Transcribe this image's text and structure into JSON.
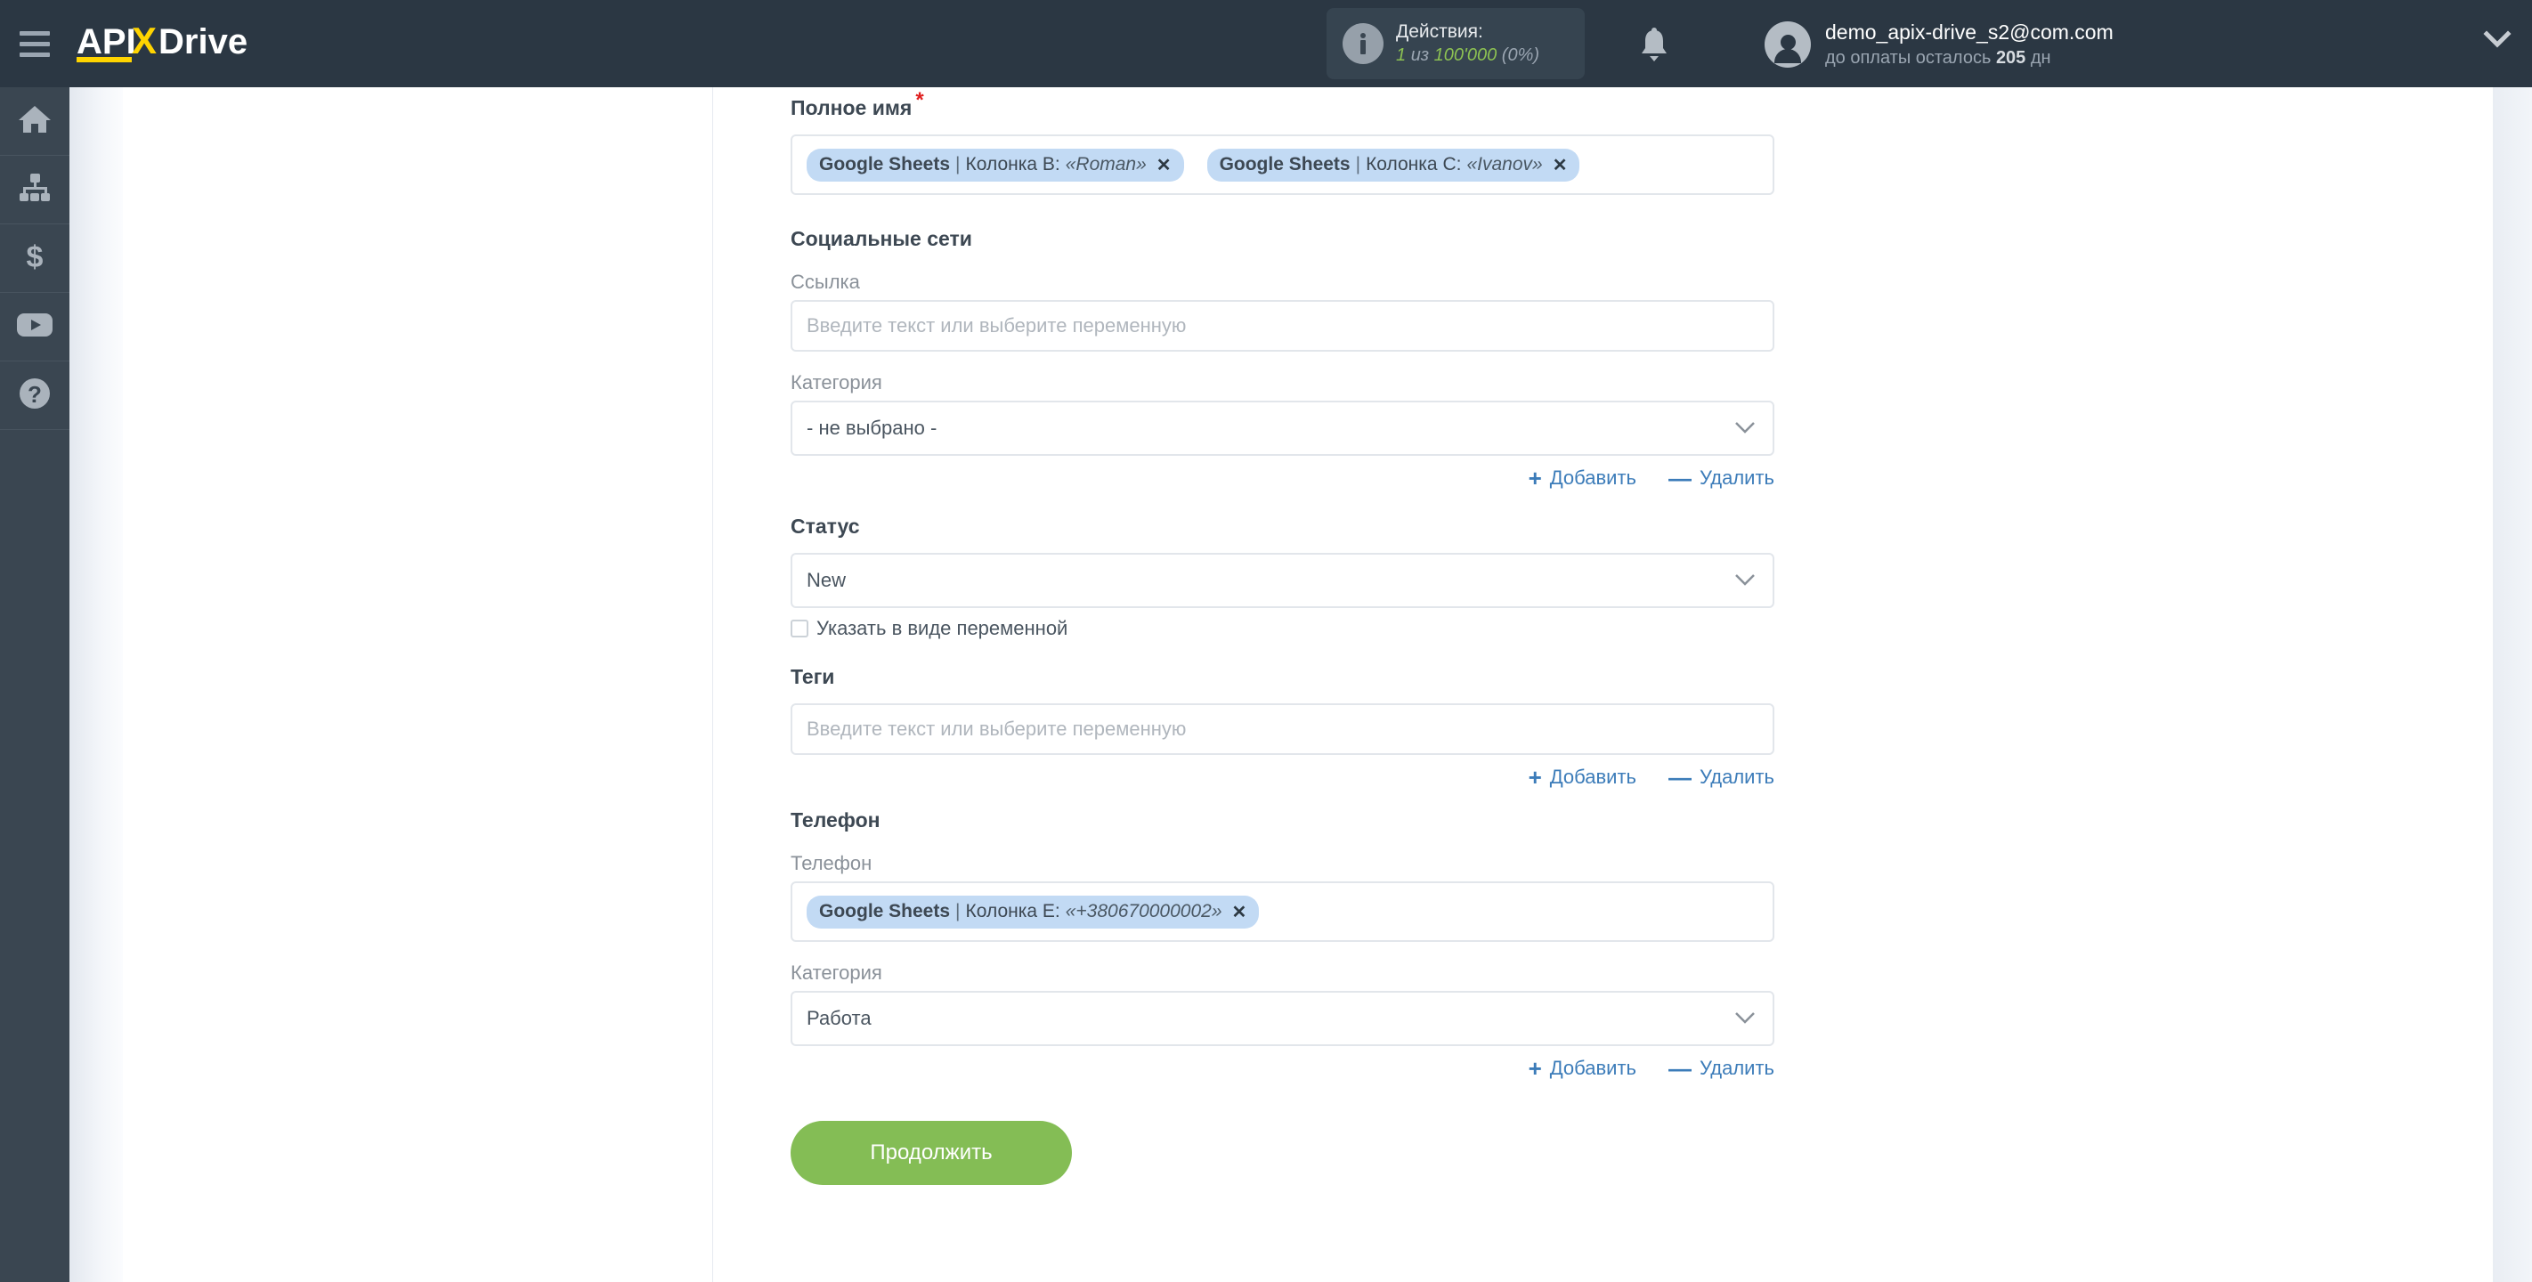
{
  "header": {
    "logo_text": "APIXDrive",
    "menu_icon": "hamburger-icon",
    "actions": {
      "title": "Действия:",
      "count": "1",
      "of": "из",
      "limit": "100'000",
      "percent": "(0%)"
    },
    "notifications_icon": "bell-icon",
    "user": {
      "email": "demo_apix-drive_s2@com.com",
      "billing_prefix": "до оплаты осталось",
      "billing_days": "205",
      "billing_suffix": "дн"
    },
    "chevron_icon": "chevron-down-icon"
  },
  "sidebar": {
    "items": [
      {
        "name": "home",
        "icon": "home-icon"
      },
      {
        "name": "connections",
        "icon": "sitemap-icon"
      },
      {
        "name": "billing",
        "icon": "dollar-icon"
      },
      {
        "name": "video",
        "icon": "youtube-play-icon"
      },
      {
        "name": "help",
        "icon": "question-circle-icon"
      }
    ]
  },
  "form": {
    "full_name": {
      "label": "Полное имя",
      "required_marker": "*",
      "chips": [
        {
          "source": "Google Sheets",
          "sep": "|",
          "field": "Колонка B:",
          "value": "«Roman»",
          "remove": "✕"
        },
        {
          "source": "Google Sheets",
          "sep": "|",
          "field": "Колонка C:",
          "value": "«Ivanov»",
          "remove": "✕"
        }
      ]
    },
    "social": {
      "section_title": "Социальные сети",
      "link_label": "Ссылка",
      "link_placeholder": "Введите текст или выберите переменную",
      "link_value": "",
      "category_label": "Категория",
      "category_value": "- не выбрано -",
      "add_label": "Добавить",
      "remove_label": "Удалить"
    },
    "status": {
      "section_title": "Статус",
      "value": "New",
      "checkbox_label": "Указать в виде переменной",
      "checked": false
    },
    "tags": {
      "section_title": "Теги",
      "placeholder": "Введите текст или выберите переменную",
      "value": "",
      "add_label": "Добавить",
      "remove_label": "Удалить"
    },
    "phone": {
      "section_title": "Телефон",
      "field_label": "Телефон",
      "chip": {
        "source": "Google Sheets",
        "sep": "|",
        "field": "Колонка E:",
        "value": "«+380670000002»",
        "remove": "✕"
      },
      "category_label": "Категория",
      "category_value": "Работа",
      "add_label": "Добавить",
      "remove_label": "Удалить"
    },
    "submit_label": "Продолжить"
  },
  "colors": {
    "header_bg": "#2b3743",
    "sidebar_bg": "#3a4651",
    "accent_green": "#84bd55",
    "link_blue": "#3c7cb9",
    "chip_blue": "#c2daf4",
    "logo_yellow": "#ffd400",
    "required_red": "#e02020"
  }
}
